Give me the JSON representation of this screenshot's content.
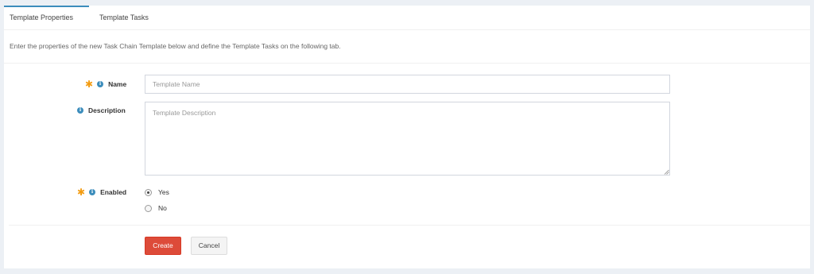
{
  "tabs": [
    {
      "label": "Template Properties",
      "active": true
    },
    {
      "label": "Template Tasks",
      "active": false
    }
  ],
  "intro": "Enter the properties of the new Task Chain Template below and define the Template Tasks on the following tab.",
  "fields": {
    "name": {
      "label": "Name",
      "placeholder": "Template Name",
      "value": "",
      "required": true
    },
    "description": {
      "label": "Description",
      "placeholder": "Template Description",
      "value": "",
      "required": false
    },
    "enabled": {
      "label": "Enabled",
      "required": true,
      "options": [
        {
          "label": "Yes",
          "checked": true
        },
        {
          "label": "No",
          "checked": false
        }
      ]
    }
  },
  "buttons": {
    "create": "Create",
    "cancel": "Cancel"
  },
  "icons": {
    "required": "asterisk-icon",
    "info": "info-icon"
  },
  "colors": {
    "accent": "#3c8dbc",
    "required": "#f39c12",
    "danger": "#dd4b39"
  }
}
